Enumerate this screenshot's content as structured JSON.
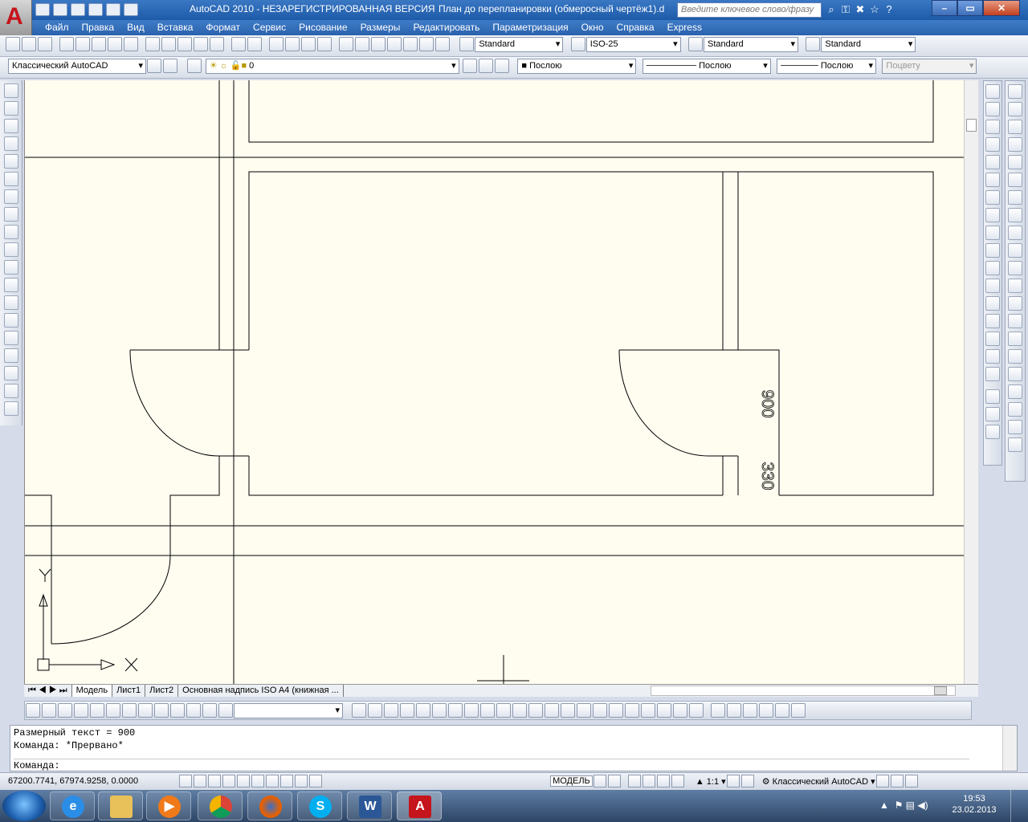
{
  "titlebar": {
    "app_title": "AutoCAD 2010 - НЕЗАРЕГИСТРИРОВАННАЯ ВЕРСИЯ",
    "document": "План до перепланировки (обмеросный чертёж1).d",
    "search_placeholder": "Введите ключевое слово/фразу",
    "logo_letter": "A"
  },
  "menu": [
    "Файл",
    "Правка",
    "Вид",
    "Вставка",
    "Формат",
    "Сервис",
    "Рисование",
    "Размеры",
    "Редактировать",
    "Параметризация",
    "Окно",
    "Справка",
    "Express"
  ],
  "styles_toolbar": {
    "text_style": "Standard",
    "dim_style": "ISO-25",
    "table_style": "Standard",
    "mleader_style": "Standard"
  },
  "workspace_toolbar": {
    "workspace": "Классический AutoCAD",
    "layer": "0",
    "color": "Послою",
    "linetype": "Послою",
    "lineweight": "Послою",
    "plotstyle": "Поцвету"
  },
  "drawing": {
    "dim_text_1": "900",
    "dim_text_2": "330",
    "ucs_y": "Y",
    "ucs_x": "X"
  },
  "layout_tabs": [
    "Модель",
    "Лист1",
    "Лист2",
    "Основная надпись ISO A4 (книжная ..."
  ],
  "command": {
    "history_1": "Размерный текст = 900",
    "history_2": "Команда: *Прервано*",
    "prompt": "Команда:"
  },
  "statusbar": {
    "coords": "67200.7741, 67974.9258, 0.0000",
    "model_label": "МОДЕЛЬ",
    "scale": "1:1",
    "workspace": "Классический AutoCAD"
  },
  "taskbar": {
    "time": "19:53",
    "date": "23.02.2013"
  },
  "colors": {
    "title_bar": "#2a62ad",
    "canvas_bg": "#fffdf0",
    "autocad_red": "#c5141b"
  }
}
